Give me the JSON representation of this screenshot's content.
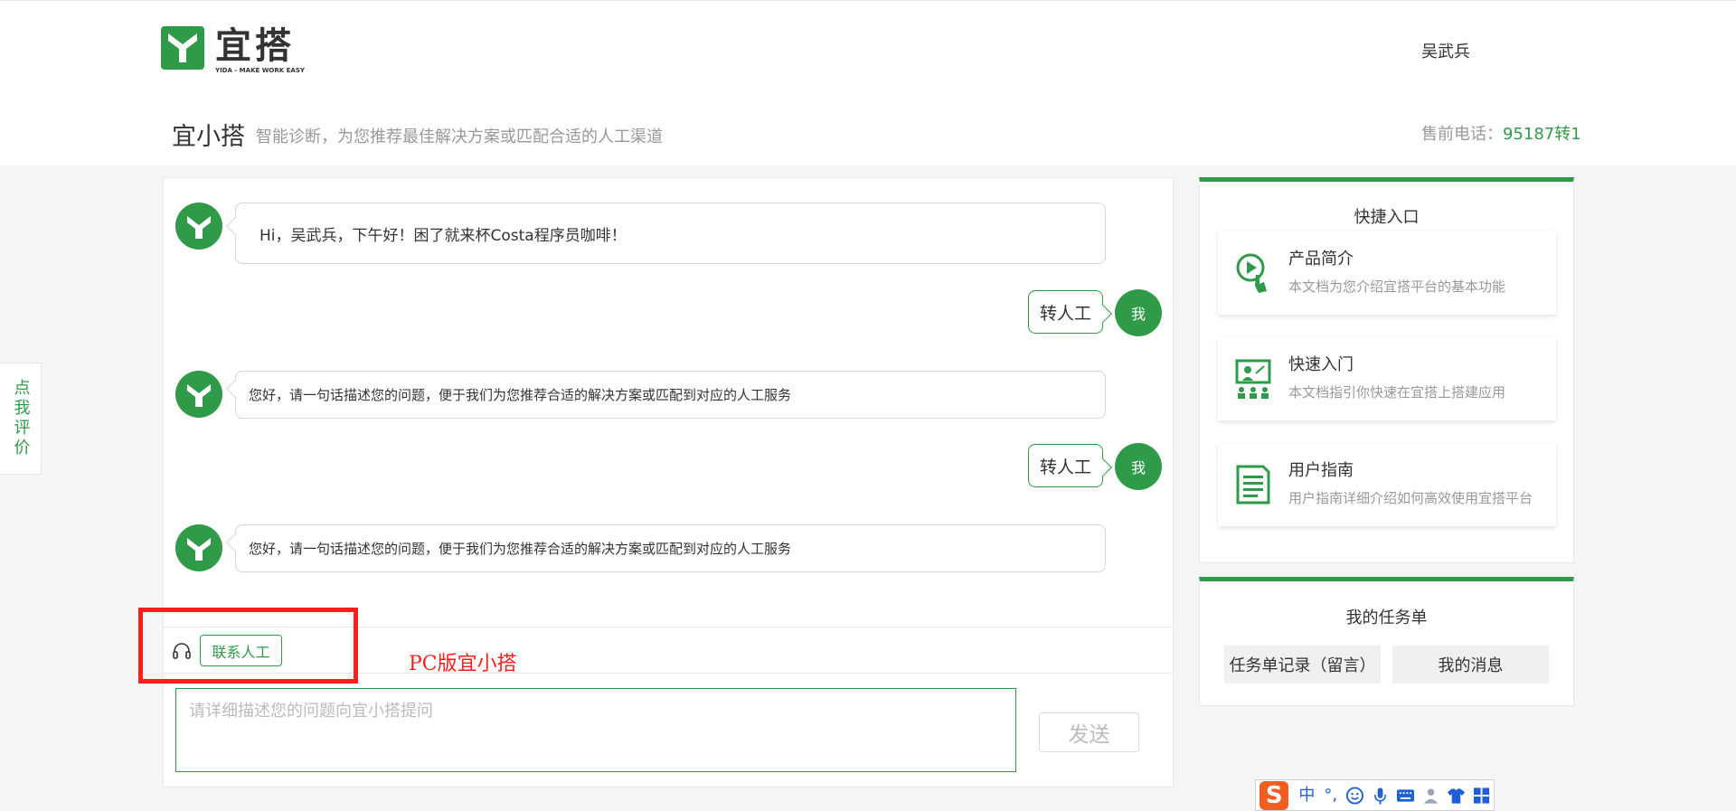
{
  "brand": {
    "name": "宜搭",
    "slogan": "YIDA - MAKE WORK EASY",
    "color": "#2f9a48"
  },
  "header": {
    "user_name": "吴武兵",
    "title": "宜小搭",
    "description": "智能诊断，为您推荐最佳解决方案或匹配合适的人工渠道",
    "hotline_label": "售前电话：",
    "hotline_number": "95187转1"
  },
  "chat": {
    "messages": [
      {
        "from": "bot",
        "text": "Hi，吴武兵，下午好！困了就来杯Costa程序员咖啡！"
      },
      {
        "from": "user",
        "text": "转人工",
        "avatar": "我"
      },
      {
        "from": "bot",
        "text": "您好，请一句话描述您的问题，便于我们为您推荐合适的解决方案或匹配到对应的人工服务"
      },
      {
        "from": "user",
        "text": "转人工",
        "avatar": "我"
      },
      {
        "from": "bot",
        "text": "您好，请一句话描述您的问题，便于我们为您推荐合适的解决方案或匹配到对应的人工服务"
      }
    ],
    "contact_label": "联系人工",
    "input_placeholder": "请详细描述您的问题向宜小搭提问",
    "send_label": "发送"
  },
  "annotation": {
    "text": "PC版宜小搭",
    "color": "#ff1e1e"
  },
  "rate_tab": {
    "label": "点我评价"
  },
  "quick": {
    "title": "快捷入口",
    "items": [
      {
        "title": "产品简介",
        "desc": "本文档为您介绍宜搭平台的基本功能",
        "icon": "play-pointer-icon"
      },
      {
        "title": "快速入门",
        "desc": "本文档指引你快速在宜搭上搭建应用",
        "icon": "presentation-icon"
      },
      {
        "title": "用户指南",
        "desc": "用户指南详细介绍如何高效使用宜搭平台",
        "icon": "document-icon"
      }
    ]
  },
  "tasks": {
    "title": "我的任务单",
    "record_label": "任务单记录（留言）",
    "message_label": "我的消息"
  },
  "ime": {
    "logo": "S",
    "mode": "中",
    "punct": "°,"
  }
}
